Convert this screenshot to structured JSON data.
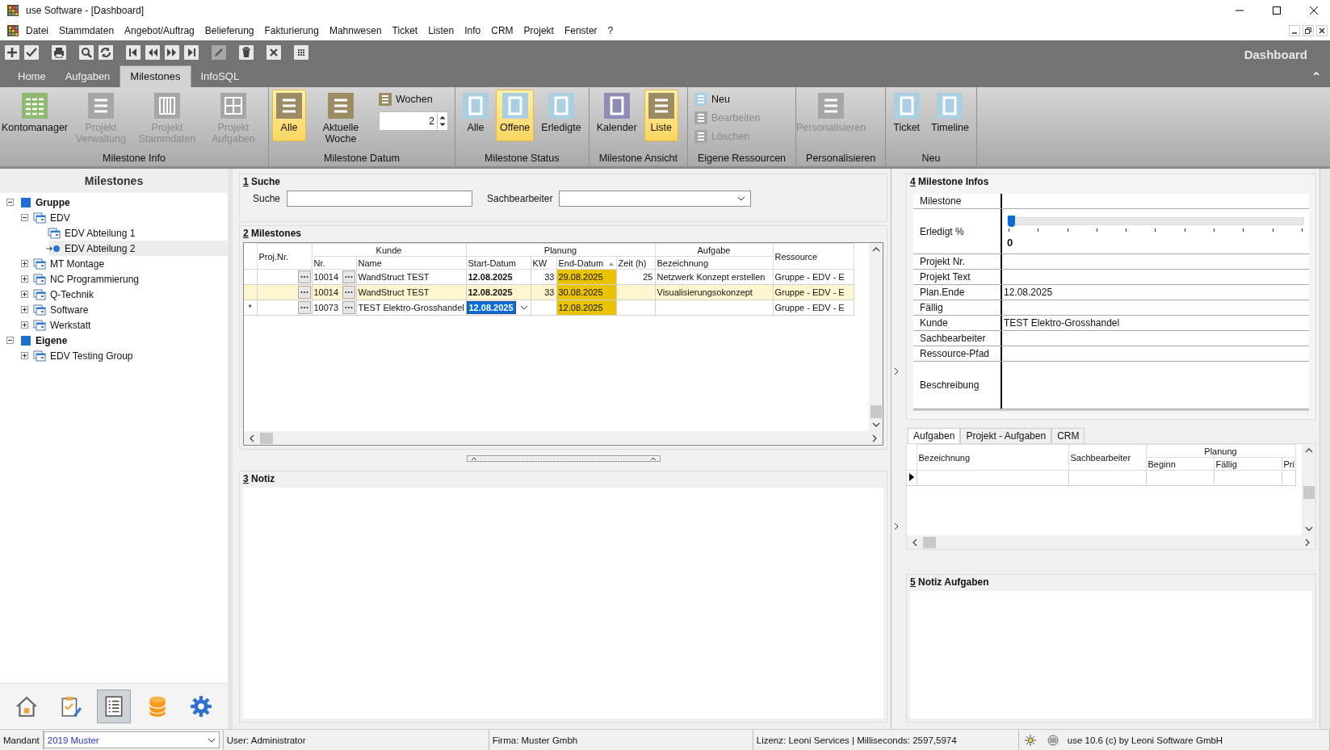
{
  "window": {
    "title": "use Software - [Dashboard]"
  },
  "menu": [
    "Datei",
    "Stammdaten",
    "Angebot/Auftrag",
    "Belieferung",
    "Fakturierung",
    "Mahnwesen",
    "Ticket",
    "Listen",
    "Info",
    "CRM",
    "Projekt",
    "Fenster",
    "?"
  ],
  "toolbar": [
    {
      "kind": "add",
      "disabled": false
    },
    {
      "kind": "check",
      "disabled": false
    },
    {
      "kind": "print",
      "disabled": false
    },
    {
      "kind": "search",
      "disabled": false
    },
    {
      "kind": "refresh",
      "disabled": false
    },
    {
      "kind": "first",
      "disabled": false
    },
    {
      "kind": "prev",
      "disabled": false
    },
    {
      "kind": "next",
      "disabled": false
    },
    {
      "kind": "last",
      "disabled": false
    },
    {
      "kind": "edit",
      "disabled": true
    },
    {
      "kind": "delete",
      "disabled": false
    },
    {
      "kind": "cancel",
      "disabled": false
    },
    {
      "kind": "grid",
      "disabled": false
    }
  ],
  "header_title": "Dashboard",
  "tabs": [
    {
      "label": "Home",
      "selected": false
    },
    {
      "label": "Aufgaben",
      "selected": false
    },
    {
      "label": "Milestones",
      "selected": true
    },
    {
      "label": "InfoSQL",
      "selected": false
    }
  ],
  "ribbon_groups": [
    {
      "label": "Milestone Info",
      "items": [
        {
          "label": "Kontomanager",
          "kind": "grid",
          "color": "#8fb870",
          "disabled": false,
          "selected": false
        },
        {
          "label": "Projekt Verwaltung",
          "kind": "lines",
          "color": "#a6a6a6",
          "disabled": true,
          "selected": false
        },
        {
          "label": "Projekt Stammdaten",
          "kind": "columns",
          "color": "#a6a6a6",
          "disabled": true,
          "selected": false
        },
        {
          "label": "Projekt Aufgaben",
          "kind": "panes",
          "color": "#a6a6a6",
          "disabled": true,
          "selected": false
        }
      ]
    },
    {
      "label": "Milestone Datum",
      "items": [
        {
          "label": "Alle",
          "kind": "lines",
          "color": "#9c8c66",
          "disabled": false,
          "selected": true
        },
        {
          "label": "Aktuelle Woche",
          "kind": "lines",
          "color": "#9c8c66",
          "disabled": false,
          "selected": false
        }
      ],
      "stack": [
        {
          "kind": "button",
          "label": "Wochen",
          "color": "#9c8c66",
          "disabled": false
        },
        {
          "kind": "spinner",
          "value": "2"
        }
      ]
    },
    {
      "label": "Milestone Status",
      "items": [
        {
          "label": "Alle",
          "kind": "frame",
          "color": "#a9cfe0",
          "disabled": false,
          "selected": false
        },
        {
          "label": "Offene",
          "kind": "frame",
          "color": "#a9cfe0",
          "disabled": false,
          "selected": true
        },
        {
          "label": "Erledigte",
          "kind": "frame",
          "color": "#a9cfe0",
          "disabled": false,
          "selected": false
        }
      ]
    },
    {
      "label": "Milestone Ansicht",
      "items": [
        {
          "label": "Kalender",
          "kind": "frame",
          "color": "#8c8cb4",
          "disabled": false,
          "selected": false
        },
        {
          "label": "Liste",
          "kind": "lines",
          "color": "#9c8c66",
          "disabled": false,
          "selected": true
        }
      ]
    },
    {
      "label": "Eigene Ressourcen",
      "stack": [
        {
          "kind": "button",
          "label": "Neu",
          "color": "#a9cfe0",
          "disabled": false
        },
        {
          "kind": "button",
          "label": "Bearbeiten",
          "color": "#a6a6a6",
          "disabled": true
        },
        {
          "kind": "button",
          "label": "Löschen",
          "color": "#a6a6a6",
          "disabled": true
        }
      ]
    },
    {
      "label": "Personalisieren",
      "items": [
        {
          "label": "Personalisieren",
          "kind": "lines",
          "color": "#a6a6a6",
          "disabled": true,
          "selected": false
        }
      ]
    },
    {
      "label": "Neu",
      "items": [
        {
          "label": "Ticket",
          "kind": "frame",
          "color": "#a9cfe0",
          "disabled": false,
          "selected": false
        },
        {
          "label": "Timeline",
          "kind": "frame",
          "color": "#a9cfe0",
          "disabled": false,
          "selected": false
        }
      ]
    }
  ],
  "left_panel": {
    "title": "Milestones"
  },
  "tree": [
    {
      "label": "Gruppe",
      "kind": "root",
      "expanded": true,
      "selected": false,
      "children": [
        {
          "label": "EDV",
          "kind": "folder",
          "expanded": true,
          "selected": false,
          "children": [
            {
              "label": "EDV Abteilung 1",
              "kind": "folder",
              "selected": false
            },
            {
              "label": "EDV Abteilung 2",
              "kind": "folder",
              "selected": true
            }
          ]
        },
        {
          "label": "MT Montage",
          "kind": "folder",
          "expanded": false,
          "selected": false
        },
        {
          "label": "NC Programmierung",
          "kind": "folder",
          "expanded": false,
          "selected": false
        },
        {
          "label": "Q-Technik",
          "kind": "folder",
          "expanded": false,
          "selected": false
        },
        {
          "label": "Software",
          "kind": "folder",
          "expanded": false,
          "selected": false
        },
        {
          "label": "Werkstatt",
          "kind": "folder",
          "expanded": false,
          "selected": false
        }
      ]
    },
    {
      "label": "Eigene",
      "kind": "root",
      "expanded": true,
      "selected": false,
      "children": [
        {
          "label": "EDV Testing Group",
          "kind": "folder",
          "expanded": false,
          "selected": false
        }
      ]
    }
  ],
  "bottom_nav": [
    {
      "kind": "home",
      "selected": false
    },
    {
      "kind": "tasks",
      "selected": false
    },
    {
      "kind": "list",
      "selected": true
    },
    {
      "kind": "database",
      "selected": false
    },
    {
      "kind": "settings",
      "selected": false
    }
  ],
  "search_panel": {
    "number": "1",
    "title": "Suche",
    "search_label": "Suche",
    "clerk_label": "Sachbearbeiter"
  },
  "milestones": {
    "number": "2",
    "title": "Milestones",
    "groups": [
      "Kunde",
      "Planung",
      "Aufgabe"
    ],
    "proj_header": "Proj.Nr.",
    "ressource_header": "Ressource",
    "columns": [
      "Nr.",
      "Name",
      "Start-Datum",
      "KW",
      "End-Datum",
      "Zeit (h)",
      "Bezeichnung"
    ],
    "rows": [
      {
        "kind": "data",
        "selected": false,
        "editing": false,
        "end_highlight": true,
        "proj_nr": "",
        "nr": "10014",
        "name": "WandStruct TEST",
        "start": "12.08.2025",
        "kw": "33",
        "end": "29.08.2025",
        "zeit": "25",
        "bezeichnung": "Netzwerk Konzept erstellen",
        "ressource": "Gruppe - EDV - E"
      },
      {
        "kind": "data",
        "selected": true,
        "editing": false,
        "end_highlight": true,
        "proj_nr": "",
        "nr": "10014",
        "name": "WandStruct TEST",
        "start": "12.08.2025",
        "kw": "33",
        "end": "30.08.2025",
        "zeit": "",
        "bezeichnung": "Visualisierungsokonzept",
        "ressource": "Gruppe - EDV - E"
      },
      {
        "kind": "new",
        "marker": "*",
        "selected": false,
        "editing": true,
        "end_highlight": true,
        "proj_nr": "",
        "nr": "10073",
        "name": "TEST Elektro-Grosshandel",
        "start": "12.08.2025",
        "kw": "",
        "end": "12.08.2025",
        "zeit": "",
        "bezeichnung": "",
        "ressource": "Gruppe - EDV - E"
      }
    ]
  },
  "notiz": {
    "number": "3",
    "title": "Notiz"
  },
  "info": {
    "number": "4",
    "title": "Milestone Infos",
    "rows": [
      {
        "kind": "text",
        "label": "Milestone",
        "value": ""
      },
      {
        "kind": "slider",
        "label": "Erledigt %",
        "level": 0,
        "reading": "0"
      },
      {
        "kind": "text",
        "label": "Projekt Nr.",
        "value": ""
      },
      {
        "kind": "text",
        "label": "Projekt Text",
        "value": ""
      },
      {
        "kind": "text",
        "label": "Plan.Ende",
        "value": "12.08.2025"
      },
      {
        "kind": "text",
        "label": "Fällig",
        "value": ""
      },
      {
        "kind": "text",
        "label": "Kunde",
        "value": "TEST Elektro-Grosshandel"
      },
      {
        "kind": "text",
        "label": "Sachbearbeiter",
        "value": ""
      },
      {
        "kind": "text",
        "label": "Ressource-Pfad",
        "value": ""
      },
      {
        "kind": "tall",
        "label": "Beschreibung",
        "value": ""
      }
    ]
  },
  "sub_tabs": [
    {
      "label": "Aufgaben",
      "selected": true
    },
    {
      "label": "Projekt - Aufgaben",
      "selected": false
    },
    {
      "label": "CRM",
      "selected": false
    }
  ],
  "sub_grid": {
    "col_bezeichnung": "Bezeichnung",
    "col_sachbearbeiter": "Sachbearbeiter",
    "group_planung": "Planung",
    "planung_columns": [
      "Beginn",
      "Fällig",
      "Pri"
    ],
    "rows": [
      {
        "current": true
      }
    ]
  },
  "notiz_aufgaben": {
    "number": "5",
    "title": "Notiz Aufgaben"
  },
  "status_bar": {
    "mandant_label": "Mandant",
    "mandant_value": "2019 Muster",
    "user": "User: Administrator",
    "firma": "Firma: Muster Gmbh",
    "lizenz": "Lizenz: Leoni Services | Milliseconds: 2597,5974",
    "version": "use 10.6 (c) by Leoni Software GmbH"
  }
}
